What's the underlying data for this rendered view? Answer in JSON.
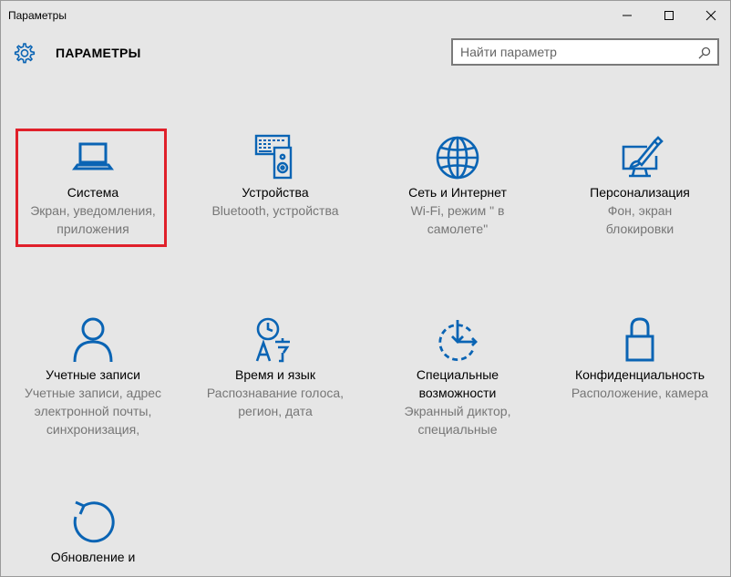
{
  "window": {
    "title": "Параметры"
  },
  "header": {
    "title": "ПАРАМЕТРЫ",
    "search_placeholder": "Найти параметр"
  },
  "tiles": [
    {
      "name": "Система",
      "desc": [
        "Экран, уведомления,",
        "приложения"
      ],
      "icon": "laptop-icon",
      "highlighted": true
    },
    {
      "name": "Устройства",
      "desc": [
        "Bluetooth, устройства"
      ],
      "icon": "devices-icon"
    },
    {
      "name": "Сеть и Интернет",
      "desc": [
        "Wi-Fi, режим \" в",
        "самолете\""
      ],
      "icon": "globe-icon"
    },
    {
      "name": "Персонализация",
      "desc": [
        "Фон, экран",
        "блокировки"
      ],
      "icon": "paint-icon"
    },
    {
      "name": "Учетные записи",
      "desc": [
        "Учетные записи, адрес",
        "электронной почты,",
        "синхронизация,"
      ],
      "icon": "person-icon"
    },
    {
      "name": "Время и язык",
      "desc": [
        "Распознавание голоса,",
        "регион, дата"
      ],
      "icon": "time-language-icon"
    },
    {
      "name": [
        "Специальные",
        "возможности"
      ],
      "desc": [
        "Экранный диктор,",
        "специальные"
      ],
      "icon": "ease-of-access-icon"
    },
    {
      "name": "Конфиденциальность",
      "desc": [
        "Расположение, камера"
      ],
      "icon": "lock-icon"
    },
    {
      "name": [
        "Обновление и"
      ],
      "desc": [],
      "icon": "update-icon"
    }
  ],
  "colors": {
    "accent": "#0a64b4",
    "highlight": "#e0202a",
    "background": "#e6e6e6"
  }
}
